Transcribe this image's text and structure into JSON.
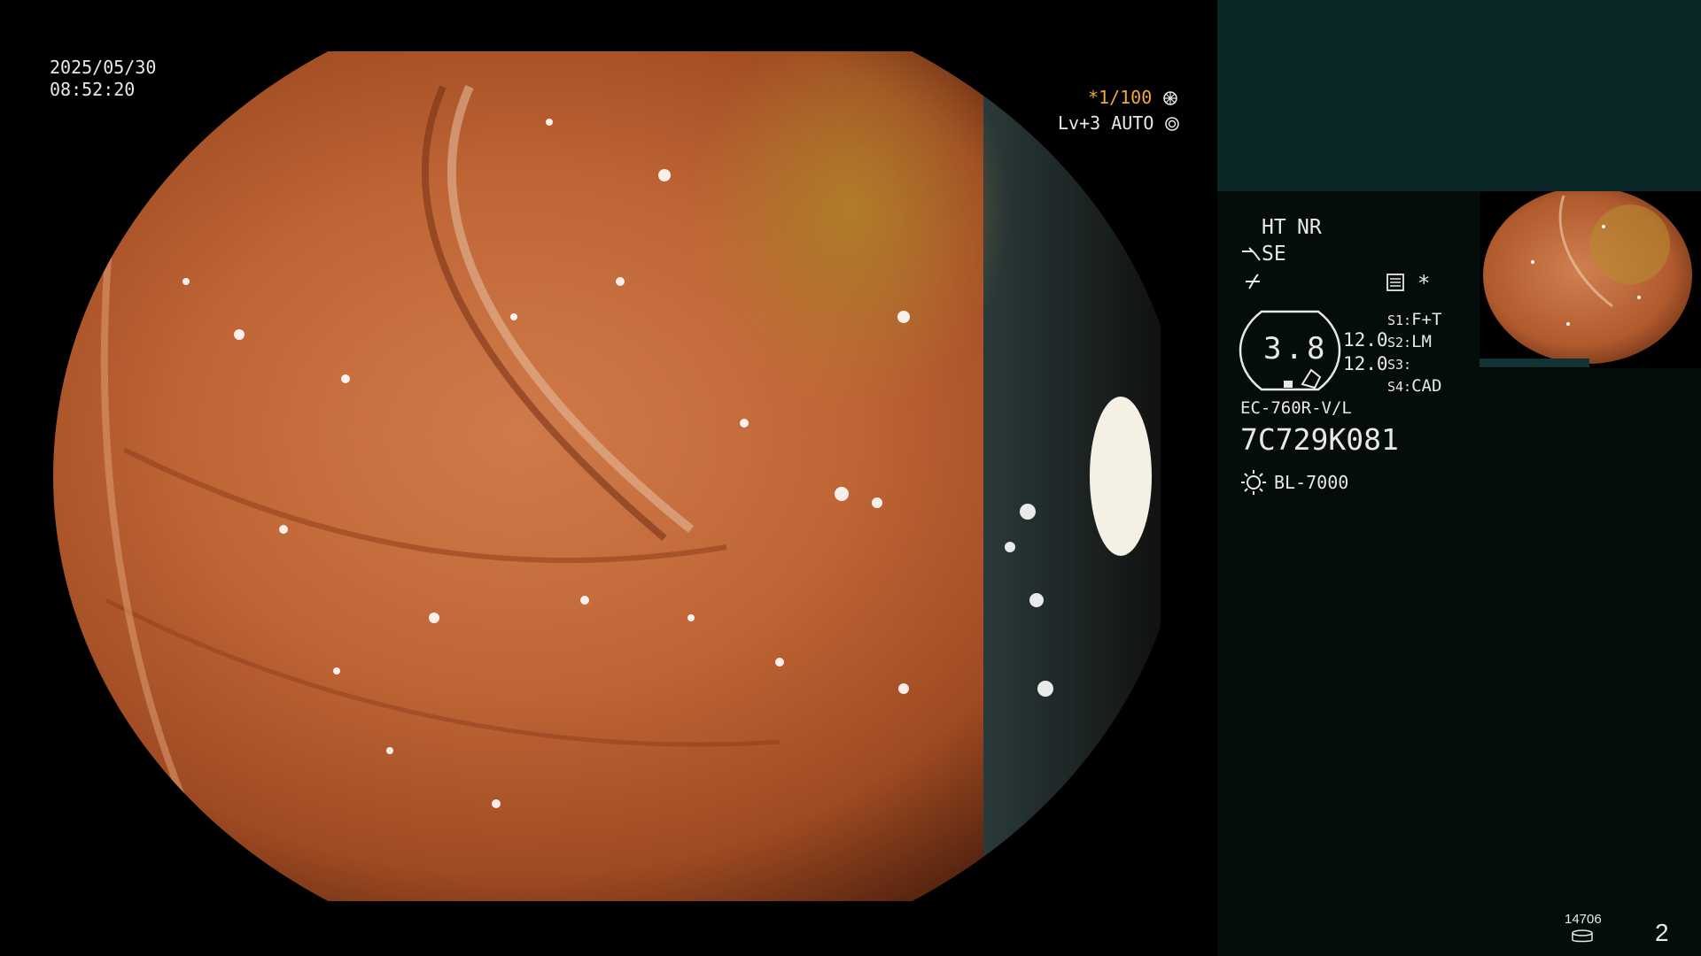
{
  "video": {
    "date": "2025/05/30",
    "time": "08:52:20",
    "shutter": "*1/100",
    "level_mode": "Lv+3 AUTO"
  },
  "panel": {
    "ht": "HT",
    "nr": "NR",
    "se": "SE",
    "zoom": "3.8",
    "val_a": "12.0",
    "val_b": "12.0",
    "s1_key": "S1:",
    "s1_val": "F+T",
    "s2_key": "S2:",
    "s2_val": "LM",
    "s3_key": "S3:",
    "s3_val": "",
    "s4_key": "S4:",
    "s4_val": "CAD",
    "scope_model": "EC-760R-V/L",
    "scope_serial": "7C729K081",
    "light_source": "BL-7000",
    "storage_count": "14706",
    "page_number": "2",
    "asterisk": "*"
  },
  "colors": {
    "amber": "#f0a838",
    "panel_bg": "#050c0c",
    "teal": "#0a2626"
  }
}
